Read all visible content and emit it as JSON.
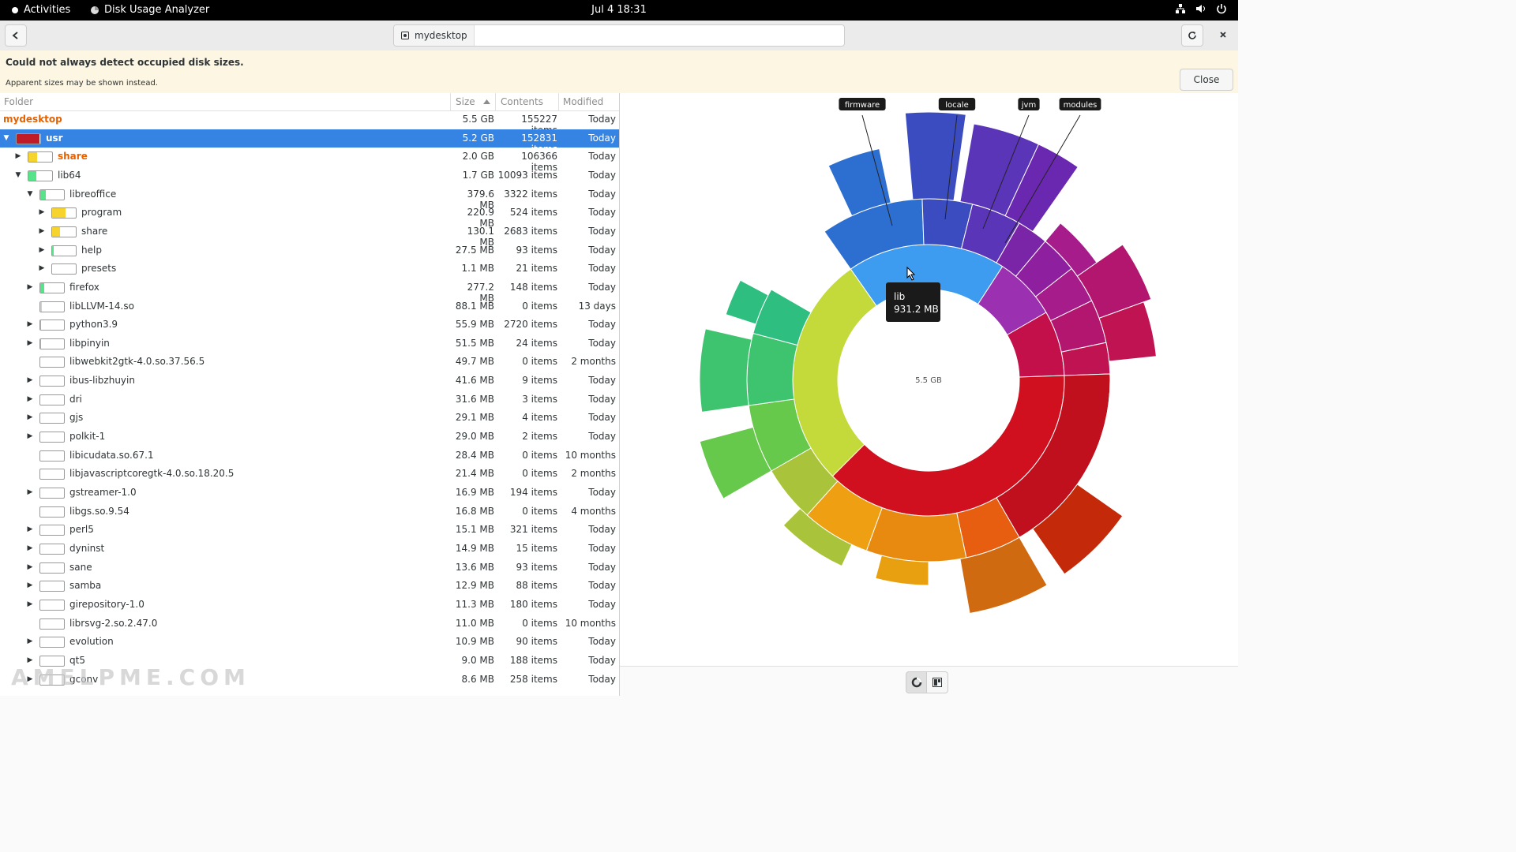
{
  "system_bar": {
    "activities": "Activities",
    "app_name": "Disk Usage Analyzer",
    "clock": "Jul 4  18:31"
  },
  "header": {
    "location": "mydesktop",
    "back_icon": "back-arrow-icon",
    "reload_icon": "reload-icon",
    "close_icon": "close-icon"
  },
  "infobar": {
    "title": "Could not always detect occupied disk sizes.",
    "message": "Apparent sizes may be shown instead.",
    "close_label": "Close"
  },
  "columns": {
    "folder": "Folder",
    "size": "Size",
    "contents": "Contents",
    "modified": "Modified"
  },
  "rows": [
    {
      "name": "mydesktop",
      "size": "5.5 GB",
      "contents": "155227 items",
      "modified": "Today",
      "level": -1,
      "expander": "none",
      "fill": 0,
      "color": "",
      "style": "root"
    },
    {
      "name": "usr",
      "size": "5.2 GB",
      "contents": "152831 items",
      "modified": "Today",
      "level": 0,
      "expander": "open",
      "fill": 0.95,
      "color": "#c01c28",
      "style": "bold"
    },
    {
      "name": "share",
      "size": "2.0 GB",
      "contents": "106366 items",
      "modified": "Today",
      "level": 1,
      "expander": "closed",
      "fill": 0.38,
      "color": "#f6d32d",
      "style": "orange"
    },
    {
      "name": "lib64",
      "size": "1.7 GB",
      "contents": "10093 items",
      "modified": "Today",
      "level": 1,
      "expander": "open",
      "fill": 0.33,
      "color": "#57e389",
      "style": ""
    },
    {
      "name": "libreoffice",
      "size": "379.6 MB",
      "contents": "3322 items",
      "modified": "Today",
      "level": 2,
      "expander": "open",
      "fill": 0.22,
      "color": "#57e389",
      "style": ""
    },
    {
      "name": "program",
      "size": "220.9 MB",
      "contents": "524 items",
      "modified": "Today",
      "level": 3,
      "expander": "closed",
      "fill": 0.58,
      "color": "#f6d32d",
      "style": ""
    },
    {
      "name": "share",
      "size": "130.1 MB",
      "contents": "2683 items",
      "modified": "Today",
      "level": 3,
      "expander": "closed",
      "fill": 0.34,
      "color": "#f6d32d",
      "style": ""
    },
    {
      "name": "help",
      "size": "27.5 MB",
      "contents": "93 items",
      "modified": "Today",
      "level": 3,
      "expander": "closed",
      "fill": 0.07,
      "color": "#57e389",
      "style": ""
    },
    {
      "name": "presets",
      "size": "1.1 MB",
      "contents": "21 items",
      "modified": "Today",
      "level": 3,
      "expander": "closed",
      "fill": 0,
      "color": "",
      "style": ""
    },
    {
      "name": "firefox",
      "size": "277.2 MB",
      "contents": "148 items",
      "modified": "Today",
      "level": 2,
      "expander": "closed",
      "fill": 0.16,
      "color": "#57e389",
      "style": ""
    },
    {
      "name": "libLLVM-14.so",
      "size": "88.1 MB",
      "contents": "0 items",
      "modified": "13 days",
      "level": 2,
      "expander": "none",
      "fill": 0.05,
      "color": "#d0d0d0",
      "style": ""
    },
    {
      "name": "python3.9",
      "size": "55.9 MB",
      "contents": "2720 items",
      "modified": "Today",
      "level": 2,
      "expander": "closed",
      "fill": 0.03,
      "color": "#57e389",
      "style": ""
    },
    {
      "name": "libpinyin",
      "size": "51.5 MB",
      "contents": "24 items",
      "modified": "Today",
      "level": 2,
      "expander": "closed",
      "fill": 0.03,
      "color": "#57e389",
      "style": ""
    },
    {
      "name": "libwebkit2gtk-4.0.so.37.56.5",
      "size": "49.7 MB",
      "contents": "0 items",
      "modified": "2 months",
      "level": 2,
      "expander": "none",
      "fill": 0,
      "color": "",
      "style": ""
    },
    {
      "name": "ibus-libzhuyin",
      "size": "41.6 MB",
      "contents": "9 items",
      "modified": "Today",
      "level": 2,
      "expander": "closed",
      "fill": 0,
      "color": "",
      "style": ""
    },
    {
      "name": "dri",
      "size": "31.6 MB",
      "contents": "3 items",
      "modified": "Today",
      "level": 2,
      "expander": "closed",
      "fill": 0,
      "color": "",
      "style": ""
    },
    {
      "name": "gjs",
      "size": "29.1 MB",
      "contents": "4 items",
      "modified": "Today",
      "level": 2,
      "expander": "closed",
      "fill": 0,
      "color": "",
      "style": ""
    },
    {
      "name": "polkit-1",
      "size": "29.0 MB",
      "contents": "2 items",
      "modified": "Today",
      "level": 2,
      "expander": "closed",
      "fill": 0,
      "color": "",
      "style": ""
    },
    {
      "name": "libicudata.so.67.1",
      "size": "28.4 MB",
      "contents": "0 items",
      "modified": "10 months",
      "level": 2,
      "expander": "none",
      "fill": 0,
      "color": "",
      "style": ""
    },
    {
      "name": "libjavascriptcoregtk-4.0.so.18.20.5",
      "size": "21.4 MB",
      "contents": "0 items",
      "modified": "2 months",
      "level": 2,
      "expander": "none",
      "fill": 0,
      "color": "",
      "style": ""
    },
    {
      "name": "gstreamer-1.0",
      "size": "16.9 MB",
      "contents": "194 items",
      "modified": "Today",
      "level": 2,
      "expander": "closed",
      "fill": 0,
      "color": "",
      "style": ""
    },
    {
      "name": "libgs.so.9.54",
      "size": "16.8 MB",
      "contents": "0 items",
      "modified": "4 months",
      "level": 2,
      "expander": "none",
      "fill": 0,
      "color": "",
      "style": ""
    },
    {
      "name": "perl5",
      "size": "15.1 MB",
      "contents": "321 items",
      "modified": "Today",
      "level": 2,
      "expander": "closed",
      "fill": 0,
      "color": "",
      "style": ""
    },
    {
      "name": "dyninst",
      "size": "14.9 MB",
      "contents": "15 items",
      "modified": "Today",
      "level": 2,
      "expander": "closed",
      "fill": 0,
      "color": "",
      "style": ""
    },
    {
      "name": "sane",
      "size": "13.6 MB",
      "contents": "93 items",
      "modified": "Today",
      "level": 2,
      "expander": "closed",
      "fill": 0,
      "color": "",
      "style": ""
    },
    {
      "name": "samba",
      "size": "12.9 MB",
      "contents": "88 items",
      "modified": "Today",
      "level": 2,
      "expander": "closed",
      "fill": 0,
      "color": "",
      "style": ""
    },
    {
      "name": "girepository-1.0",
      "size": "11.3 MB",
      "contents": "180 items",
      "modified": "Today",
      "level": 2,
      "expander": "closed",
      "fill": 0,
      "color": "",
      "style": ""
    },
    {
      "name": "librsvg-2.so.2.47.0",
      "size": "11.0 MB",
      "contents": "0 items",
      "modified": "10 months",
      "level": 2,
      "expander": "none",
      "fill": 0,
      "color": "",
      "style": ""
    },
    {
      "name": "evolution",
      "size": "10.9 MB",
      "contents": "90 items",
      "modified": "Today",
      "level": 2,
      "expander": "closed",
      "fill": 0,
      "color": "",
      "style": ""
    },
    {
      "name": "qt5",
      "size": "9.0 MB",
      "contents": "188 items",
      "modified": "Today",
      "level": 2,
      "expander": "closed",
      "fill": 0,
      "color": "",
      "style": ""
    },
    {
      "name": "gconv",
      "size": "8.6 MB",
      "contents": "258 items",
      "modified": "Today",
      "level": 2,
      "expander": "closed",
      "fill": 0,
      "color": "",
      "style": ""
    }
  ],
  "chart": {
    "center_label": "5.5 GB",
    "tooltip_name": "lib",
    "tooltip_size": "931.2 MB",
    "callouts": [
      "firmware",
      "locale",
      "jvm",
      "modules"
    ]
  },
  "view_buttons": {
    "rings_icon": "rings-chart-icon",
    "treemap_icon": "treemap-chart-icon"
  },
  "watermark": "AMELPME.COM"
}
